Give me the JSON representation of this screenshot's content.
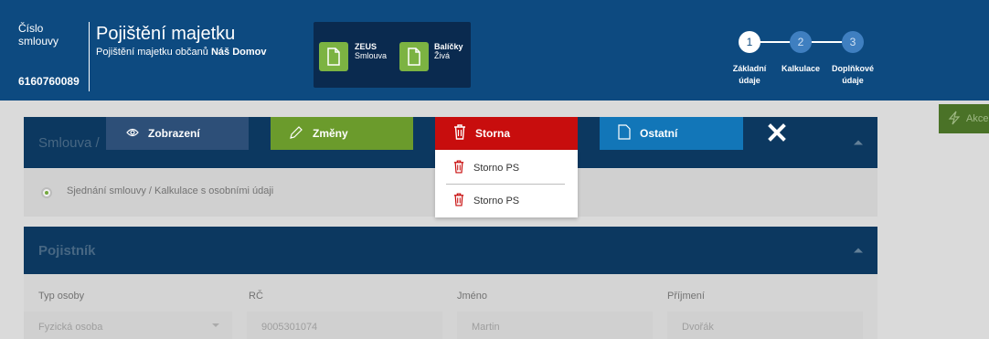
{
  "header": {
    "contract_label": "Číslo smlouvy",
    "contract_number": "6160760089",
    "title": "Pojištění majetku",
    "subtitle_prefix": "Pojištění majetku občanů",
    "subtitle_product": "Náš Domov",
    "docs": [
      {
        "title": "ZEUS",
        "subtitle": "Smlouva",
        "icon": "document-icon"
      },
      {
        "title": "Balíčky",
        "subtitle": "Živá",
        "icon": "document-icon"
      }
    ],
    "steps": [
      {
        "num": "1",
        "label": "Základní údaje",
        "active": true
      },
      {
        "num": "2",
        "label": "Kalkulace",
        "active": false
      },
      {
        "num": "3",
        "label": "Doplňkové údaje",
        "active": false
      }
    ]
  },
  "side_action": {
    "label": "Akce",
    "icon": "lightning-icon"
  },
  "toolbar": {
    "view_label": "Zobrazení",
    "changes_label": "Změny",
    "storno_label": "Storna",
    "other_label": "Ostatní",
    "storno_menu": [
      "Storno PS",
      "Storno PS"
    ]
  },
  "section1": {
    "title": "Smlouva /",
    "row_text": "Sjednání smlouvy / Kalkulace s osobními údaji"
  },
  "section2": {
    "title": "Pojistník",
    "fields": [
      {
        "label": "Typ osoby",
        "value": "Fyzická osoba"
      },
      {
        "label": "RČ",
        "value": "9005301074"
      },
      {
        "label": "Jméno",
        "value": "Martin"
      },
      {
        "label": "Příjmení",
        "value": "Dvořák"
      }
    ]
  },
  "colors": {
    "header_bg": "#0d4a80",
    "storno_red": "#c80d0d",
    "changes_green": "#6b9b2c",
    "other_blue": "#1276b8",
    "view_navy": "#2d4f78"
  }
}
